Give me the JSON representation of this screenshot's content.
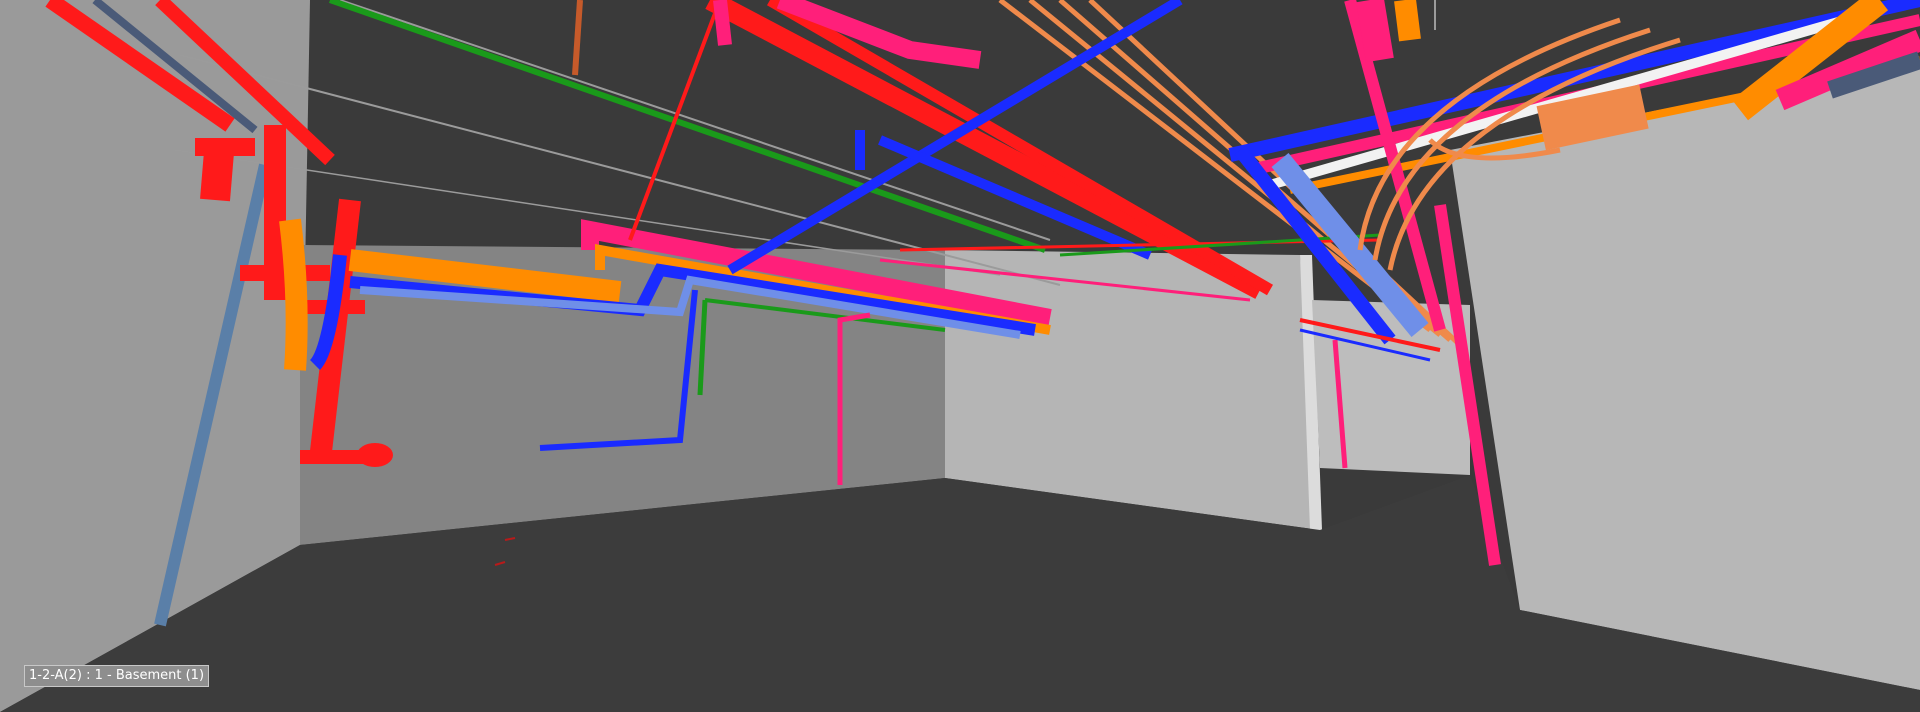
{
  "viewport": {
    "view_label": "1-2-A(2) : 1 - Basement (1)"
  },
  "colors": {
    "ceiling": "#3a3a3a",
    "floor": "#3a3a3a",
    "wall_left": "#9a9a9a",
    "wall_back": "#848484",
    "wall_right": "#b7b7b7",
    "fire_pipe": "#ff1a1a",
    "hot_pipe": "#ff8c00",
    "blue_pipe": "#1a2bff",
    "light_blue_pipe": "#6f8fe8",
    "green_pipe": "#1a9a1a",
    "magenta_pipe": "#ff1f7a",
    "copper_pipe": "#f08a4b",
    "white_pipe": "#f2f2f2",
    "steel_column": "#5a7fa8"
  }
}
